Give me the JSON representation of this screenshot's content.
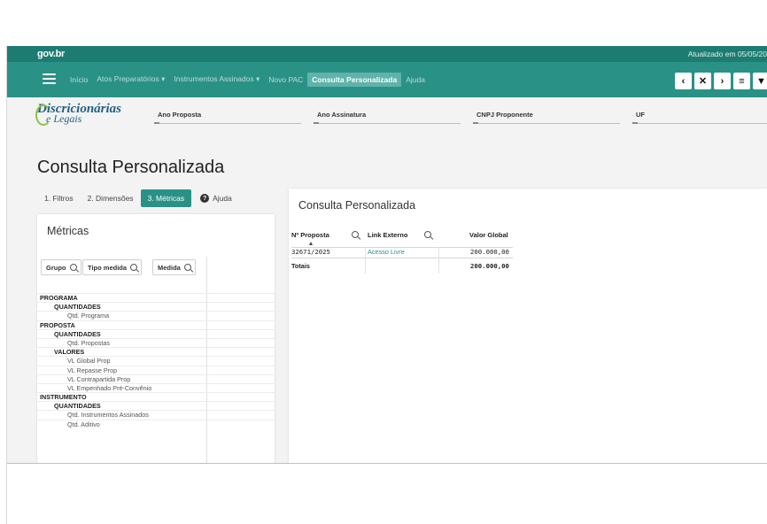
{
  "gov": {
    "logo": "gov.br",
    "updated": "Atualizado em 05/05/20"
  },
  "nav": {
    "items": [
      {
        "label": "Início",
        "active": false
      },
      {
        "label": "Atos Preparatórios ▾",
        "active": false
      },
      {
        "label": "Instrumentos Assinados ▾",
        "active": false
      },
      {
        "label": "Novo PAC",
        "active": false
      },
      {
        "label": "Consulta Personalizada",
        "active": true
      },
      {
        "label": "Ajuda",
        "active": false
      }
    ],
    "buttons": {
      "prev": "‹",
      "close": "✕",
      "next": "›",
      "menu": "≡",
      "filter": "▼"
    }
  },
  "brand": {
    "line1": "Discricionárias",
    "line2": "e Legais"
  },
  "filters": {
    "ano_proposta": "Ano Proposta",
    "ano_assinatura": "Ano Assinatura",
    "cnpj": "CNPJ Proponente",
    "uf": "UF"
  },
  "page_title": "Consulta Personalizada",
  "tabs": {
    "filtros": "1. Filtros",
    "dimensoes": "2. Dimensões",
    "metricas": "3. Métricas",
    "ajuda": "Ajuda"
  },
  "metrics_panel": {
    "title": "Métricas",
    "search": {
      "grupo": "Grupo",
      "tipo": "Tipo medida",
      "medida": "Medida"
    },
    "tree": [
      {
        "level": 0,
        "label": "PROGRAMA"
      },
      {
        "level": 1,
        "label": "QUANTIDADES"
      },
      {
        "level": 2,
        "label": "Qtd. Programa"
      },
      {
        "level": 0,
        "label": "PROPOSTA"
      },
      {
        "level": 1,
        "label": "QUANTIDADES"
      },
      {
        "level": 2,
        "label": "Qtd. Propostas"
      },
      {
        "level": 1,
        "label": "VALORES"
      },
      {
        "level": 2,
        "label": "VL Global Prop"
      },
      {
        "level": 2,
        "label": "VL Repasse Prop"
      },
      {
        "level": 2,
        "label": "VL Contrapartida Prop"
      },
      {
        "level": 2,
        "label": "VL Empenhado Pré-Convênio"
      },
      {
        "level": 0,
        "label": "INSTRUMENTO"
      },
      {
        "level": 1,
        "label": "QUANTIDADES"
      },
      {
        "level": 2,
        "label": "Qtd. Instrumentos Assinados"
      },
      {
        "level": 2,
        "label": "Qtd. Aditivo"
      }
    ]
  },
  "results_panel": {
    "title": "Consulta Personalizada",
    "headers": {
      "proposta": "Nº Proposta",
      "link": "Link Externo",
      "valor": "Valor Global"
    },
    "row": {
      "proposta": "32671/2025",
      "link": "Acesso Livre",
      "valor": "200.000,00"
    },
    "totals": {
      "label": "Totais",
      "valor": "200.000,00"
    }
  },
  "colors": {
    "header": "#1d7c72",
    "nav": "#2a9187",
    "accent": "#2a9187",
    "brand": "#1f5f85"
  }
}
